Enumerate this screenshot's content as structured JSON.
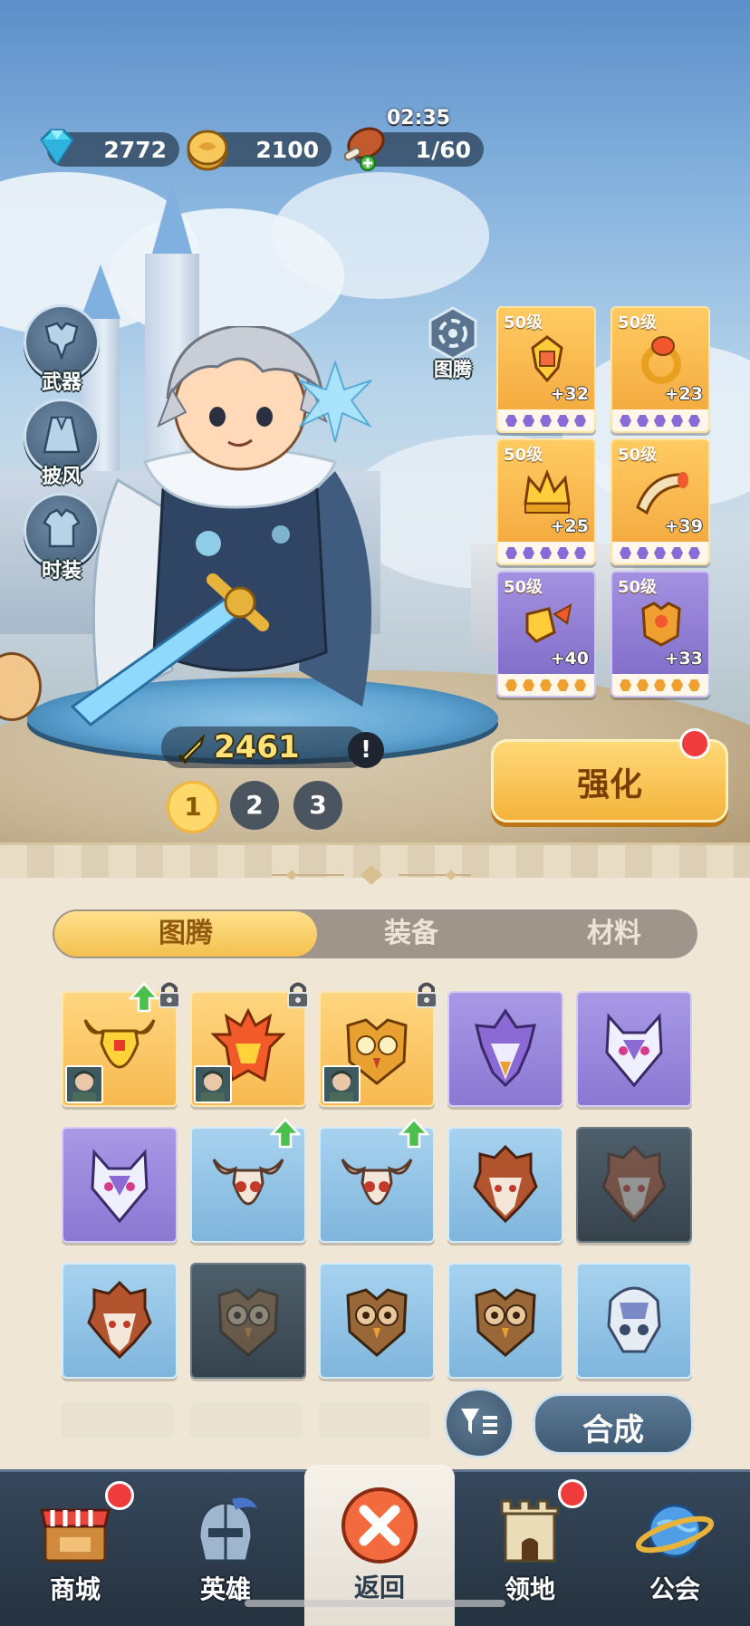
{
  "resources": {
    "gems": "2772",
    "coins": "2100",
    "stamina": "1/60",
    "stamina_timer": "02:35"
  },
  "side_buttons": [
    {
      "label": "武器",
      "icon": "weapon-armor-icon"
    },
    {
      "label": "披风",
      "icon": "cape-icon"
    },
    {
      "label": "时装",
      "icon": "costume-icon"
    }
  ],
  "totem_button": {
    "label": "图腾",
    "icon": "totem-swirl-icon"
  },
  "equipment": [
    {
      "level": "50级",
      "plus": "+32",
      "rarity": "gold",
      "icon": "amulet-icon"
    },
    {
      "level": "50级",
      "plus": "+23",
      "rarity": "gold",
      "icon": "ring-icon"
    },
    {
      "level": "50级",
      "plus": "+25",
      "rarity": "gold",
      "icon": "crown-icon"
    },
    {
      "level": "50级",
      "plus": "+39",
      "rarity": "gold",
      "icon": "horn-icon"
    },
    {
      "level": "50级",
      "plus": "+40",
      "rarity": "purple",
      "icon": "winged-boots-icon"
    },
    {
      "level": "50级",
      "plus": "+33",
      "rarity": "purple",
      "icon": "armor-icon"
    }
  ],
  "hero": {
    "power": "2461",
    "info": "!"
  },
  "loadout_pages": [
    "1",
    "2",
    "3"
  ],
  "upgrade_button": {
    "label": "强化"
  },
  "tabs": [
    {
      "label": "图腾",
      "active": true
    },
    {
      "label": "装备",
      "active": false
    },
    {
      "label": "材料",
      "active": false
    }
  ],
  "totems": [
    {
      "rarity": "gold",
      "mask": "bull-mask-icon",
      "upgrade": true,
      "locked": true,
      "equipped": true
    },
    {
      "rarity": "gold",
      "mask": "phoenix-mask-icon",
      "upgrade": false,
      "locked": true,
      "equipped": true
    },
    {
      "rarity": "gold",
      "mask": "owl-mask-icon",
      "upgrade": false,
      "locked": true,
      "equipped": true
    },
    {
      "rarity": "purple",
      "mask": "eagle-mask-icon",
      "upgrade": false,
      "locked": false,
      "equipped": false
    },
    {
      "rarity": "purple",
      "mask": "wolf-mask-icon",
      "upgrade": false,
      "locked": false,
      "equipped": false
    },
    {
      "rarity": "purple",
      "mask": "wolf-mask-icon",
      "upgrade": false,
      "locked": false,
      "equipped": false
    },
    {
      "rarity": "blue",
      "mask": "bull-skull-icon",
      "upgrade": true,
      "locked": false,
      "equipped": false
    },
    {
      "rarity": "blue",
      "mask": "bull-skull-icon",
      "upgrade": true,
      "locked": false,
      "equipped": false
    },
    {
      "rarity": "blue",
      "mask": "bird-skull-icon",
      "upgrade": false,
      "locked": false,
      "equipped": false
    },
    {
      "rarity": "dark",
      "mask": "bird-skull-icon",
      "upgrade": false,
      "locked": false,
      "equipped": false
    },
    {
      "rarity": "blue",
      "mask": "bird-skull-icon",
      "upgrade": false,
      "locked": false,
      "equipped": false
    },
    {
      "rarity": "dark",
      "mask": "owl-wood-icon",
      "upgrade": false,
      "locked": false,
      "equipped": false
    },
    {
      "rarity": "blue",
      "mask": "owl-wood-icon",
      "upgrade": false,
      "locked": false,
      "equipped": false
    },
    {
      "rarity": "blue",
      "mask": "owl-wood-icon",
      "upgrade": false,
      "locked": false,
      "equipped": false
    },
    {
      "rarity": "blue",
      "mask": "stone-skull-icon",
      "upgrade": false,
      "locked": false,
      "equipped": false
    }
  ],
  "actions": {
    "filter_icon": "filter-sort-icon",
    "combine": "合成"
  },
  "nav": [
    {
      "label": "商城",
      "icon": "shop-icon",
      "badge": true
    },
    {
      "label": "英雄",
      "icon": "helmet-icon",
      "badge": false
    },
    {
      "label": "返回",
      "icon": "close-x-icon",
      "badge": false,
      "active": true
    },
    {
      "label": "领地",
      "icon": "castle-icon",
      "badge": true
    },
    {
      "label": "公会",
      "icon": "planet-icon",
      "badge": false
    }
  ],
  "colors": {
    "gold_rarity": "#f7b950",
    "purple_rarity": "#8a78d2",
    "blue_rarity": "#7fb5dc",
    "badge_red": "#ef3b3b",
    "power_yellow": "#ffe37a"
  }
}
